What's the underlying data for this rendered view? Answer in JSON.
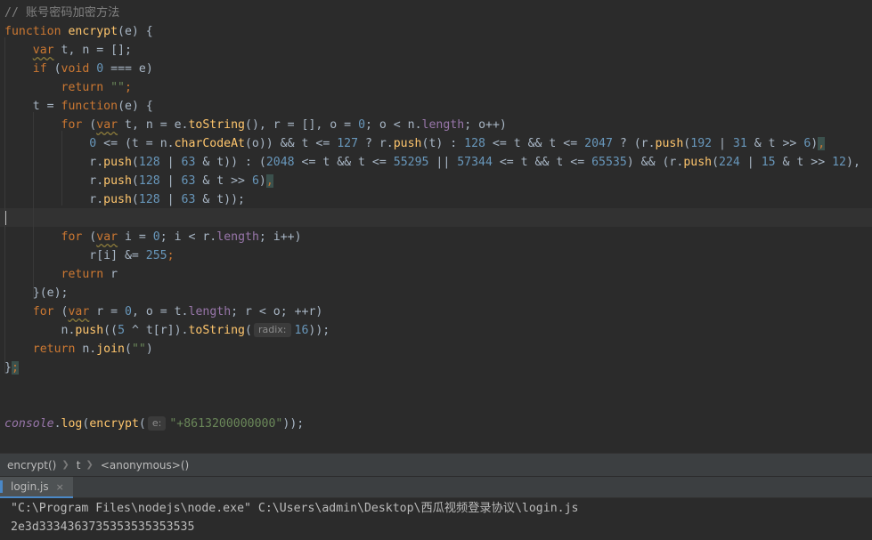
{
  "editor": {
    "lines": [
      {
        "tokens": [
          {
            "t": "// 账号密码加密方法",
            "c": "cmt"
          }
        ]
      },
      {
        "tokens": [
          {
            "t": "function ",
            "c": "kw"
          },
          {
            "t": "encrypt",
            "c": "fn"
          },
          {
            "t": "(e) {",
            "c": ""
          }
        ]
      },
      {
        "tokens": [
          {
            "t": "    ",
            "c": ""
          },
          {
            "t": "var",
            "c": "kw sq"
          },
          {
            "t": " t, n = [];",
            "c": ""
          }
        ]
      },
      {
        "tokens": [
          {
            "t": "    ",
            "c": ""
          },
          {
            "t": "if ",
            "c": "kw"
          },
          {
            "t": "(",
            "c": ""
          },
          {
            "t": "void ",
            "c": "kw"
          },
          {
            "t": "0",
            "c": "num"
          },
          {
            "t": " === e)",
            "c": ""
          }
        ]
      },
      {
        "tokens": [
          {
            "t": "        ",
            "c": ""
          },
          {
            "t": "return ",
            "c": "kw"
          },
          {
            "t": "\"\"",
            "c": "str"
          },
          {
            "t": ";",
            "c": "kw"
          }
        ]
      },
      {
        "tokens": [
          {
            "t": "    t = ",
            "c": ""
          },
          {
            "t": "function",
            "c": "kw"
          },
          {
            "t": "(e) {",
            "c": ""
          }
        ]
      },
      {
        "tokens": [
          {
            "t": "        ",
            "c": ""
          },
          {
            "t": "for ",
            "c": "kw"
          },
          {
            "t": "(",
            "c": ""
          },
          {
            "t": "var",
            "c": "kw sq"
          },
          {
            "t": " t, n = e.",
            "c": ""
          },
          {
            "t": "toString",
            "c": "fn"
          },
          {
            "t": "(), r = [], o = ",
            "c": ""
          },
          {
            "t": "0",
            "c": "num"
          },
          {
            "t": "; o < n.",
            "c": ""
          },
          {
            "t": "length",
            "c": "prop"
          },
          {
            "t": "; o++)",
            "c": ""
          }
        ]
      },
      {
        "tokens": [
          {
            "t": "            ",
            "c": ""
          },
          {
            "t": "0",
            "c": "num"
          },
          {
            "t": " <= (t = n.",
            "c": ""
          },
          {
            "t": "charCodeAt",
            "c": "fn"
          },
          {
            "t": "(o)) && t <= ",
            "c": ""
          },
          {
            "t": "127",
            "c": "num"
          },
          {
            "t": " ? r.",
            "c": ""
          },
          {
            "t": "push",
            "c": "fn"
          },
          {
            "t": "(t) : ",
            "c": ""
          },
          {
            "t": "128",
            "c": "num"
          },
          {
            "t": " <= t && t <= ",
            "c": ""
          },
          {
            "t": "2047",
            "c": "num"
          },
          {
            "t": " ? (r.",
            "c": ""
          },
          {
            "t": "push",
            "c": "fn"
          },
          {
            "t": "(",
            "c": ""
          },
          {
            "t": "192",
            "c": "num"
          },
          {
            "t": " | ",
            "c": ""
          },
          {
            "t": "31",
            "c": "num"
          },
          {
            "t": " & t >> ",
            "c": ""
          },
          {
            "t": "6",
            "c": "num"
          },
          {
            "t": ")",
            "c": ""
          },
          {
            "t": ",",
            "c": "kw brace-hl"
          }
        ]
      },
      {
        "tokens": [
          {
            "t": "            r.",
            "c": ""
          },
          {
            "t": "push",
            "c": "fn"
          },
          {
            "t": "(",
            "c": ""
          },
          {
            "t": "128",
            "c": "num"
          },
          {
            "t": " | ",
            "c": ""
          },
          {
            "t": "63",
            "c": "num"
          },
          {
            "t": " & t)) : (",
            "c": ""
          },
          {
            "t": "2048",
            "c": "num"
          },
          {
            "t": " <= t && t <= ",
            "c": ""
          },
          {
            "t": "55295",
            "c": "num"
          },
          {
            "t": " || ",
            "c": ""
          },
          {
            "t": "57344",
            "c": "num"
          },
          {
            "t": " <= t && t <= ",
            "c": ""
          },
          {
            "t": "65535",
            "c": "num"
          },
          {
            "t": ") && (r.",
            "c": ""
          },
          {
            "t": "push",
            "c": "fn"
          },
          {
            "t": "(",
            "c": ""
          },
          {
            "t": "224",
            "c": "num"
          },
          {
            "t": " | ",
            "c": ""
          },
          {
            "t": "15",
            "c": "num"
          },
          {
            "t": " & t >> ",
            "c": ""
          },
          {
            "t": "12",
            "c": "num"
          },
          {
            "t": "),",
            "c": ""
          }
        ]
      },
      {
        "tokens": [
          {
            "t": "            r.",
            "c": ""
          },
          {
            "t": "push",
            "c": "fn"
          },
          {
            "t": "(",
            "c": ""
          },
          {
            "t": "128",
            "c": "num"
          },
          {
            "t": " | ",
            "c": ""
          },
          {
            "t": "63",
            "c": "num"
          },
          {
            "t": " & t >> ",
            "c": ""
          },
          {
            "t": "6",
            "c": "num"
          },
          {
            "t": ")",
            "c": ""
          },
          {
            "t": ",",
            "c": "kw brace-hl"
          }
        ]
      },
      {
        "tokens": [
          {
            "t": "            r.",
            "c": ""
          },
          {
            "t": "push",
            "c": "fn"
          },
          {
            "t": "(",
            "c": ""
          },
          {
            "t": "128",
            "c": "num"
          },
          {
            "t": " | ",
            "c": ""
          },
          {
            "t": "63",
            "c": "num"
          },
          {
            "t": " & t));",
            "c": ""
          }
        ]
      },
      {
        "tokens": []
      },
      {
        "tokens": [
          {
            "t": "        ",
            "c": ""
          },
          {
            "t": "for ",
            "c": "kw"
          },
          {
            "t": "(",
            "c": ""
          },
          {
            "t": "var",
            "c": "kw sq"
          },
          {
            "t": " i = ",
            "c": ""
          },
          {
            "t": "0",
            "c": "num"
          },
          {
            "t": "; i < r.",
            "c": ""
          },
          {
            "t": "length",
            "c": "prop"
          },
          {
            "t": "; i++)",
            "c": ""
          }
        ]
      },
      {
        "tokens": [
          {
            "t": "            r[i] &= ",
            "c": ""
          },
          {
            "t": "255",
            "c": "num"
          },
          {
            "t": ";",
            "c": "kw"
          }
        ]
      },
      {
        "tokens": [
          {
            "t": "        ",
            "c": ""
          },
          {
            "t": "return ",
            "c": "kw"
          },
          {
            "t": "r",
            "c": ""
          }
        ]
      },
      {
        "tokens": [
          {
            "t": "    }(e);",
            "c": ""
          }
        ]
      },
      {
        "tokens": [
          {
            "t": "    ",
            "c": ""
          },
          {
            "t": "for ",
            "c": "kw"
          },
          {
            "t": "(",
            "c": ""
          },
          {
            "t": "var",
            "c": "kw sq"
          },
          {
            "t": " r = ",
            "c": ""
          },
          {
            "t": "0",
            "c": "num"
          },
          {
            "t": ", o = t.",
            "c": ""
          },
          {
            "t": "length",
            "c": "prop"
          },
          {
            "t": "; r < o; ++r)",
            "c": ""
          }
        ]
      },
      {
        "tokens": [
          {
            "t": "        n.",
            "c": ""
          },
          {
            "t": "push",
            "c": "fn"
          },
          {
            "t": "((",
            "c": ""
          },
          {
            "t": "5",
            "c": "num"
          },
          {
            "t": " ^ t[r]).",
            "c": ""
          },
          {
            "t": "toString",
            "c": "fn"
          },
          {
            "t": "(",
            "c": ""
          },
          {
            "t": "radix:",
            "c": "hint"
          },
          {
            "t": "16",
            "c": "num"
          },
          {
            "t": "));",
            "c": ""
          }
        ]
      },
      {
        "tokens": [
          {
            "t": "    ",
            "c": ""
          },
          {
            "t": "return ",
            "c": "kw"
          },
          {
            "t": "n.",
            "c": ""
          },
          {
            "t": "join",
            "c": "fn"
          },
          {
            "t": "(",
            "c": ""
          },
          {
            "t": "\"\"",
            "c": "str"
          },
          {
            "t": ")",
            "c": ""
          }
        ]
      },
      {
        "tokens": [
          {
            "t": "}",
            "c": ""
          },
          {
            "t": ";",
            "c": "kw brace-hl"
          }
        ]
      },
      {
        "tokens": []
      },
      {
        "tokens": []
      },
      {
        "tokens": [
          {
            "t": "console",
            "c": "gl"
          },
          {
            "t": ".",
            "c": ""
          },
          {
            "t": "log",
            "c": "fn"
          },
          {
            "t": "(",
            "c": ""
          },
          {
            "t": "encrypt",
            "c": "fn"
          },
          {
            "t": "(",
            "c": ""
          },
          {
            "t": "e:",
            "c": "hint"
          },
          {
            "t": "\"+8613200000000\"",
            "c": "str"
          },
          {
            "t": "));",
            "c": ""
          }
        ]
      }
    ]
  },
  "breadcrumb": {
    "items": [
      "encrypt()",
      "t",
      "<anonymous>()"
    ]
  },
  "run": {
    "tab_label": "login.js",
    "close_glyph": "×"
  },
  "console": {
    "command": "\"C:\\Program Files\\nodejs\\node.exe\" C:\\Users\\admin\\Desktop\\西瓜视频登录协议\\login.js",
    "output": "2e3d3334363735353535353535"
  },
  "colors": {
    "background": "#2b2b2b",
    "keyword": "#cc7832",
    "function": "#ffc66d",
    "number": "#6897bb",
    "string": "#6a8759",
    "comment": "#808080",
    "property": "#9876aa",
    "text": "#a9b7c6"
  }
}
